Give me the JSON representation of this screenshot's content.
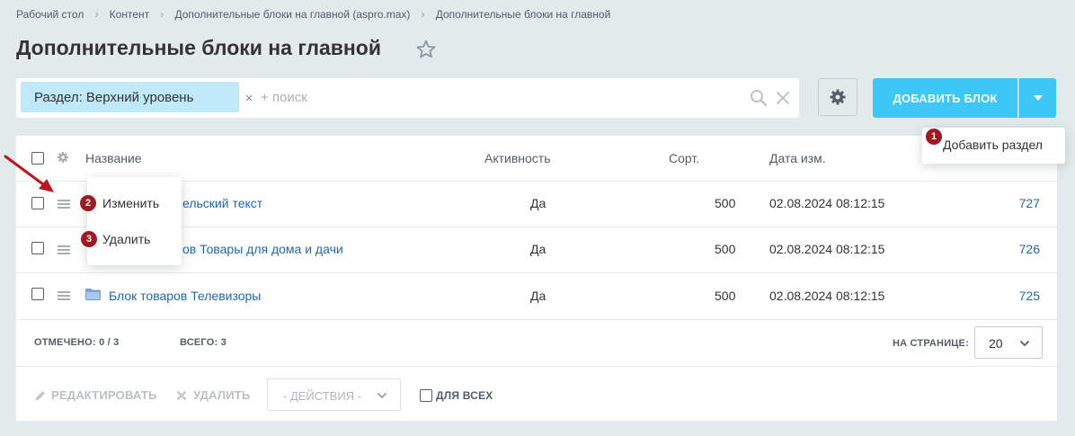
{
  "breadcrumbs": [
    "Рабочий стол",
    "Контент",
    "Дополнительные блоки на главной (aspro.max)",
    "Дополнительные блоки на главной"
  ],
  "page_title": "Дополнительные блоки на главной",
  "filter": {
    "chip_label": "Раздел: Верхний уровень",
    "chip_clear": "×",
    "search_placeholder": "+ поиск",
    "search_value": ""
  },
  "toolbar": {
    "add_label": "ДОБАВИТЬ БЛОК",
    "dropdown_item": "Добавить раздел"
  },
  "table": {
    "columns": [
      "Название",
      "Активность",
      "Сорт.",
      "Дата изм."
    ],
    "rows": [
      {
        "name": "ельский текст",
        "active": "Да",
        "sort": "500",
        "date": "02.08.2024 08:12:15",
        "id": "727"
      },
      {
        "name": "ов Товары для дома и дачи",
        "active": "Да",
        "sort": "500",
        "date": "02.08.2024 08:12:15",
        "id": "726"
      },
      {
        "name": "Блок товаров Телевизоры",
        "active": "Да",
        "sort": "500",
        "date": "02.08.2024 08:12:15",
        "id": "725"
      }
    ]
  },
  "context_menu": {
    "edit": "Изменить",
    "delete": "Удалить"
  },
  "badges": {
    "one": "1",
    "two": "2",
    "three": "3"
  },
  "footer": {
    "selected_label": "ОТМЕЧЕНО:",
    "selected_value": "0 / 3",
    "total_label": "ВСЕГО:",
    "total_value": "3",
    "per_page_label": "НА СТРАНИЦЕ:",
    "per_page_value": "20"
  },
  "actions": {
    "edit": "РЕДАКТИРОВАТЬ",
    "delete": "УДАЛИТЬ",
    "select": "- ДЕЙСТВИЯ -",
    "for_all": "ДЛЯ ВСЕХ"
  },
  "colors": {
    "background": "#e3eaec",
    "accent": "#3bc8f5",
    "chip": "#bfe8f8",
    "link": "#2067b0",
    "badge": "#a11920",
    "annotation_arrow": "#c0151c"
  },
  "icons": [
    "star-icon",
    "search-icon",
    "close-icon",
    "gear-icon",
    "chevron-down-icon",
    "drag-handle-icon",
    "folder-icon",
    "pencil-icon",
    "cross-icon"
  ]
}
